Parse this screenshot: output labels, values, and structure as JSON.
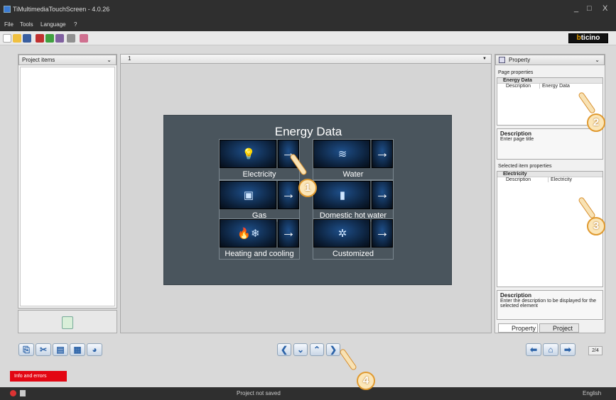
{
  "window": {
    "title": "TiMultimediaTouchScreen - 4.0.26",
    "minimize": "_",
    "maximize": "□",
    "close": "X"
  },
  "menu": {
    "items": [
      "File",
      "Tools",
      "Language",
      "?"
    ]
  },
  "brand": {
    "logo_prefix": "b",
    "logo_rest": "ticino"
  },
  "left_panel": {
    "title": "Project items",
    "pin": "⌄"
  },
  "page_selector": {
    "value": "1",
    "dropdown": "▼"
  },
  "screen": {
    "title": "Energy Data",
    "tiles": [
      {
        "label": "Electricity",
        "icon": "bulb-plug-icon",
        "glyph": "💡",
        "arrow": "→"
      },
      {
        "label": "Water",
        "icon": "water-icon",
        "glyph": "≋",
        "arrow": "→"
      },
      {
        "label": "Gas",
        "icon": "gas-meter-icon",
        "glyph": "▣",
        "arrow": "→"
      },
      {
        "label": "Domestic hot water",
        "icon": "boiler-icon",
        "glyph": "▮",
        "arrow": "→"
      },
      {
        "label": "Heating and cooling",
        "icon": "flame-snow-icon",
        "glyph": "🔥❄",
        "arrow": "→"
      },
      {
        "label": "Customized",
        "icon": "custom-icon",
        "glyph": "✲",
        "arrow": "→"
      }
    ]
  },
  "right_panel": {
    "title": "Property",
    "page_properties_label": "Page properties",
    "page_group": "Energy Data",
    "page_desc_key": "Description",
    "page_desc_value": "Energy Data",
    "desc_box1_title": "Description",
    "desc_box1_text": "Enter page title",
    "selected_label": "Selected item properties",
    "item_group": "Electricity",
    "item_desc_key": "Description",
    "item_desc_value": "Electricity",
    "desc_box2_title": "Description",
    "desc_box2_text": "Enter the description to be displayed for the selected element",
    "tab_property": "Property",
    "tab_project": "Project"
  },
  "nav": {
    "left": "❮",
    "down": "⌄",
    "up": "⌃",
    "right": "❯",
    "back": "⬅",
    "home": "⌂",
    "forward": "➡",
    "page_counter": "2/4"
  },
  "info_button": "Info and errors",
  "status": {
    "message": "Project not saved",
    "language": "English"
  },
  "callouts": [
    "1",
    "2",
    "3",
    "4"
  ]
}
